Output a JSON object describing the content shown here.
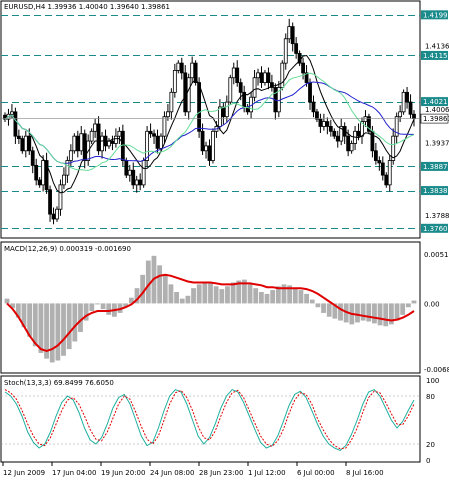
{
  "window": {
    "header": "EURUSD,H4  1.39936 1.40040 1.39640 1.39861"
  },
  "colors": {
    "background": "#ffffff",
    "grid_line": "#000000",
    "bull_candle": "#ffffff",
    "bear_candle": "#000000",
    "ma_fast": "#000000",
    "ma_mid": "#2222cc",
    "ma_slow": "#66dd99",
    "level_line": "#1a8a8a",
    "level_tag_bg": "#1a8a8a",
    "current_price_tag_bg": "#ffffff",
    "macd_hist": "#b0b0b0",
    "macd_signal": "#e00000",
    "stoch_main": "#20b0a0",
    "stoch_signal": "#e00000"
  },
  "price_panel": {
    "ylim": [
      1.3745,
      1.4205
    ],
    "levels": [
      {
        "value": 1.41992,
        "label": "1.41992"
      },
      {
        "value": 1.41158,
        "label": "1.41158"
      },
      {
        "value": 1.4021,
        "label": "1.40210"
      },
      {
        "value": 1.38879,
        "label": "1.38879"
      },
      {
        "value": 1.38383,
        "label": "1.38383"
      },
      {
        "value": 1.37608,
        "label": "1.37608"
      }
    ],
    "current": {
      "value": 1.39861,
      "label": "1.39861"
    },
    "axis_labels": [
      {
        "value": 1.41365,
        "label": "1.41365"
      },
      {
        "value": 1.4006,
        "label": "1.40060"
      },
      {
        "value": 1.3937,
        "label": "1.39370"
      },
      {
        "value": 1.3788,
        "label": "1.37880"
      }
    ]
  },
  "macd_panel": {
    "label": "MACD(12,26,9) 0.000319 -0.001690",
    "ylim": [
      -0.0071,
      0.0054
    ],
    "axis_labels": [
      {
        "value": 0.005177,
        "label": "0.005177"
      },
      {
        "value": 0.0,
        "label": "0.00"
      },
      {
        "value": -0.006871,
        "label": "-0.006871"
      }
    ]
  },
  "stoch_panel": {
    "label": "Stoch(13,3,3) 69.8499 76.6050",
    "ylim": [
      0,
      100
    ],
    "axis_labels": [
      {
        "value": 100,
        "label": "100"
      },
      {
        "value": 80,
        "label": "80"
      },
      {
        "value": 20,
        "label": "20"
      },
      {
        "value": 0,
        "label": "0"
      }
    ]
  },
  "time_axis": [
    "12 Jun 2009",
    "17 Jun 04:00",
    "19 Jun 20:00",
    "24 Jun 08:00",
    "28 Jun 23:00",
    "1 Jul 12:00",
    "6 Jul 00:00",
    "8 Jul 16:00"
  ],
  "chart_data": {
    "type": "candlestick",
    "symbol": "EURUSD",
    "timeframe": "H4",
    "x": [
      "12 Jun 2009",
      "17 Jun 04:00",
      "19 Jun 20:00",
      "24 Jun 08:00",
      "28 Jun 23:00",
      "1 Jul 12:00",
      "6 Jul 00:00",
      "8 Jul 16:00"
    ],
    "close_path": [
      1.3985,
      1.3995,
      1.4,
      1.395,
      1.3945,
      1.392,
      1.395,
      1.392,
      1.389,
      1.386,
      1.385,
      1.39,
      1.384,
      1.379,
      1.378,
      1.38,
      1.385,
      1.387,
      1.39,
      1.392,
      1.395,
      1.392,
      1.3955,
      1.39,
      1.394,
      1.396,
      1.3975,
      1.392,
      1.395,
      1.393,
      1.394,
      1.3935,
      1.395,
      1.396,
      1.39,
      1.387,
      1.388,
      1.385,
      1.386,
      1.385,
      1.39,
      1.396,
      1.3955,
      1.395,
      1.3925,
      1.395,
      1.399,
      1.4,
      1.404,
      1.4085,
      1.41,
      1.408,
      1.4,
      1.407,
      1.41,
      1.406,
      1.396,
      1.392,
      1.393,
      1.39,
      1.396,
      1.397,
      1.401,
      1.399,
      1.402,
      1.407,
      1.409,
      1.406,
      1.404,
      1.401,
      1.4,
      1.403,
      1.407,
      1.408,
      1.406,
      1.408,
      1.406,
      1.405,
      1.4,
      1.405,
      1.41,
      1.415,
      1.4175,
      1.414,
      1.412,
      1.41,
      1.408,
      1.406,
      1.402,
      1.4,
      1.3985,
      1.397,
      1.398,
      1.397,
      1.396,
      1.395,
      1.394,
      1.397,
      1.395,
      1.392,
      1.3935,
      1.396,
      1.395,
      1.398,
      1.399,
      1.396,
      1.392,
      1.39,
      1.3895,
      1.387,
      1.385,
      1.39,
      1.395,
      1.399,
      1.4,
      1.404,
      1.402,
      1.3995,
      1.3986
    ],
    "macd_hist": [
      0.0005,
      -0.0005,
      -0.0015,
      -0.0025,
      -0.0035,
      -0.0045,
      -0.0052,
      -0.0058,
      -0.0062,
      -0.006,
      -0.0055,
      -0.0048,
      -0.004,
      -0.003,
      -0.0018,
      -0.0008,
      0.0,
      -0.0006,
      -0.0012,
      -0.0014,
      -0.001,
      -0.0004,
      0.0006,
      0.0016,
      0.003,
      0.0045,
      0.005,
      0.004,
      0.003,
      0.002,
      0.0012,
      0.0005,
      0.0008,
      0.0016,
      0.002,
      0.0022,
      0.0021,
      0.0018,
      0.0015,
      0.0018,
      0.0022,
      0.0024,
      0.0025,
      0.002,
      0.0016,
      0.0012,
      0.001,
      0.0014,
      0.0018,
      0.002,
      0.0019,
      0.0016,
      0.0014,
      0.001,
      0.0004,
      -0.0004,
      -0.001,
      -0.0014,
      -0.0016,
      -0.0018,
      -0.002,
      -0.0022,
      -0.002,
      -0.0018,
      -0.0019,
      -0.0021,
      -0.0023,
      -0.0024,
      -0.0022,
      -0.0018,
      -0.0012,
      -0.0004,
      0.0003
    ],
    "macd_signal": [
      0.0,
      -0.0006,
      -0.0014,
      -0.0024,
      -0.0034,
      -0.0042,
      -0.0048,
      -0.005,
      -0.0048,
      -0.0044,
      -0.0038,
      -0.0031,
      -0.0024,
      -0.0018,
      -0.0013,
      -0.001,
      -0.0008,
      -0.0008,
      -0.0008,
      -0.0007,
      -0.0006,
      -0.0004,
      -0.0001,
      0.0004,
      0.0011,
      0.0019,
      0.0026,
      0.0029,
      0.003,
      0.0029,
      0.0027,
      0.0025,
      0.0023,
      0.0022,
      0.0022,
      0.0022,
      0.0022,
      0.0021,
      0.002,
      0.002,
      0.002,
      0.0021,
      0.0021,
      0.0021,
      0.002,
      0.0019,
      0.0017,
      0.0017,
      0.0016,
      0.0016,
      0.0016,
      0.0016,
      0.0016,
      0.0015,
      0.0013,
      0.001,
      0.0006,
      0.0002,
      -0.0002,
      -0.0006,
      -0.0009,
      -0.0011,
      -0.0012,
      -0.0013,
      -0.0014,
      -0.0015,
      -0.0016,
      -0.0017,
      -0.0018,
      -0.0017,
      -0.0015,
      -0.0012,
      -0.0008
    ],
    "stoch_main": [
      85,
      80,
      70,
      55,
      35,
      22,
      15,
      20,
      35,
      55,
      72,
      80,
      75,
      60,
      40,
      25,
      20,
      28,
      45,
      65,
      78,
      82,
      70,
      50,
      30,
      18,
      22,
      40,
      62,
      80,
      88,
      85,
      70,
      50,
      30,
      20,
      28,
      45,
      65,
      80,
      88,
      85,
      72,
      55,
      38,
      22,
      15,
      18,
      30,
      48,
      68,
      82,
      86,
      78,
      62,
      45,
      30,
      20,
      15,
      12,
      18,
      32,
      50,
      70,
      85,
      88,
      80,
      65,
      50,
      40,
      48,
      62,
      75
    ],
    "stoch_signal": [
      88,
      84,
      76,
      62,
      45,
      30,
      20,
      18,
      28,
      45,
      62,
      75,
      78,
      70,
      55,
      38,
      26,
      24,
      35,
      52,
      70,
      80,
      76,
      60,
      42,
      26,
      20,
      30,
      50,
      70,
      84,
      87,
      78,
      62,
      42,
      28,
      25,
      36,
      55,
      72,
      84,
      87,
      78,
      62,
      46,
      30,
      20,
      17,
      24,
      38,
      58,
      75,
      84,
      82,
      70,
      52,
      38,
      26,
      18,
      14,
      15,
      25,
      40,
      60,
      78,
      86,
      84,
      72,
      58,
      45,
      44,
      55,
      70
    ]
  }
}
